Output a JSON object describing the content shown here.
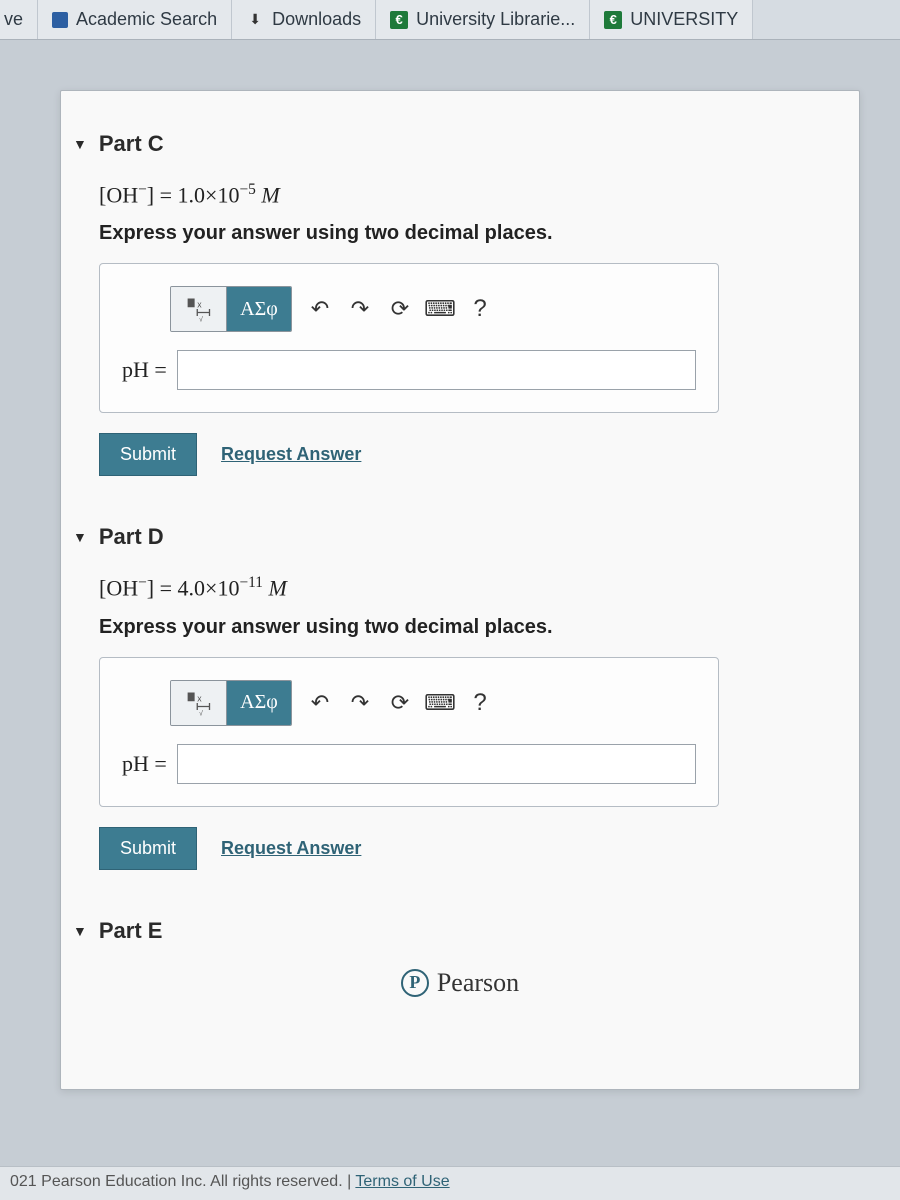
{
  "tabs": [
    {
      "label": "ve"
    },
    {
      "label": "Academic Search"
    },
    {
      "label": "Downloads"
    },
    {
      "label": "University Librarie..."
    },
    {
      "label": "UNIVERSITY"
    }
  ],
  "parts": {
    "c": {
      "title": "Part C",
      "formula_html": "[OH⁻] = 1.0×10⁻⁵ M",
      "instruction": "Express your answer using two decimal places.",
      "label": "pH =",
      "value": "",
      "submit": "Submit",
      "request": "Request Answer",
      "greek": "ΑΣφ",
      "help": "?"
    },
    "d": {
      "title": "Part D",
      "formula_html": "[OH⁻] = 4.0×10⁻¹¹ M",
      "instruction": "Express your answer using two decimal places.",
      "label": "pH =",
      "value": "",
      "submit": "Submit",
      "request": "Request Answer",
      "greek": "ΑΣφ",
      "help": "?"
    },
    "e": {
      "title": "Part E"
    }
  },
  "brand": "Pearson",
  "footer": {
    "copyright": "021 Pearson Education Inc. All rights reserved. | ",
    "terms": "Terms of Use"
  }
}
